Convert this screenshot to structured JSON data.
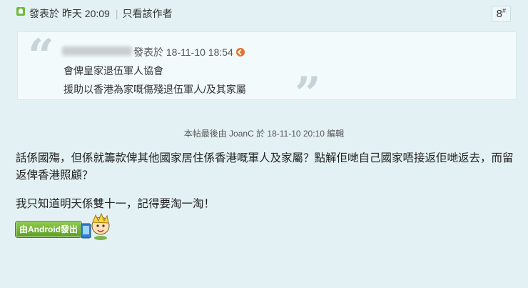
{
  "header": {
    "posted_label": "發表於",
    "posted_time": "昨天 20:09",
    "only_author": "只看該作者",
    "floor_number": "8",
    "floor_suffix": "#"
  },
  "quote": {
    "posted_label": "發表於",
    "posted_time": "18-11-10 18:54",
    "lines": [
      "會俾皇家退伍軍人協會",
      "援助以香港為家嘅傷殘退伍軍人/及其家屬"
    ]
  },
  "edit_note": "本帖最後由 JoanC 於 18-11-10 20:10 編輯",
  "body": {
    "paragraph1": "話係國殤，但係就籌款俾其他國家居住係香港嘅軍人及家屬？點解佢哋自己國家唔接返佢哋返去，而留返俾香港照顧？",
    "paragraph2": "我只知道明天係雙十一，記得要淘一淘！"
  },
  "android_badge": "由Android發出",
  "colors": {
    "background": "#e4f1f4",
    "quote_bg": "#f3fafb",
    "badge": "#6cb132",
    "goto_icon": "#e8702a"
  }
}
